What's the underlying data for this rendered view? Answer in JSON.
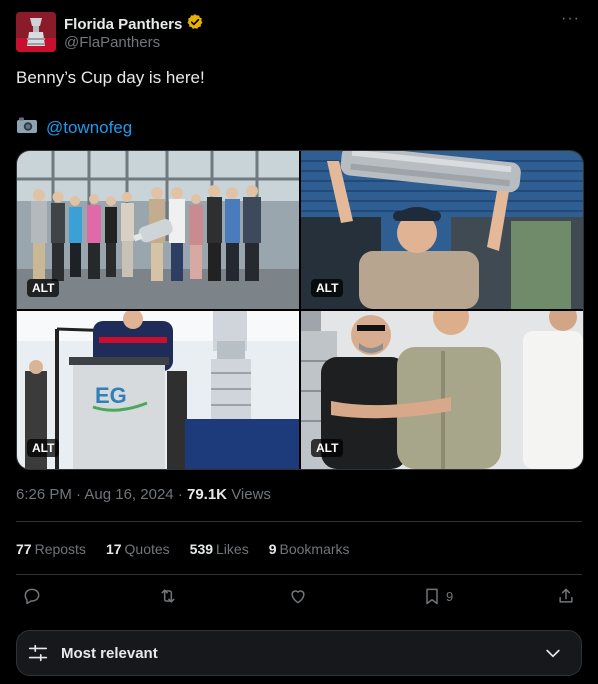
{
  "author": {
    "display_name": "Florida Panthers",
    "handle": "@FlaPanthers",
    "verified_icon": "verified-badge-gold",
    "badge_color": "#e8b300"
  },
  "more_icon": "more-horizontal-icon",
  "tweet": {
    "text": "Benny’s Cup day is here!",
    "credit_icon": "camera-emoji",
    "credit_mention": "@townofeg"
  },
  "media": {
    "alt_label": "ALT",
    "photos": [
      {
        "name": "group-photo"
      },
      {
        "name": "cup-raise-photo"
      },
      {
        "name": "podium-photo",
        "podium_sign": "EG"
      },
      {
        "name": "crowd-photo"
      }
    ]
  },
  "meta": {
    "time": "6:26 PM",
    "date": "Aug 16, 2024",
    "views_count": "79.1K",
    "views_label": "Views"
  },
  "stats": {
    "reposts_count": "77",
    "reposts_label": "Reposts",
    "quotes_count": "17",
    "quotes_label": "Quotes",
    "likes_count": "539",
    "likes_label": "Likes",
    "bookmarks_count": "9",
    "bookmarks_label": "Bookmarks"
  },
  "actions": {
    "reply_icon": "reply-icon",
    "repost_icon": "repost-icon",
    "like_icon": "like-icon",
    "bookmark_icon": "bookmark-icon",
    "bookmark_count": "9",
    "share_icon": "share-icon"
  },
  "sort": {
    "icon": "sliders-icon",
    "label": "Most relevant",
    "chevron": "chevron-down-icon"
  },
  "colors": {
    "background": "#000000",
    "text": "#e7e9ea",
    "secondary": "#71767b",
    "link": "#1d9bf0",
    "border": "#2f3336"
  }
}
